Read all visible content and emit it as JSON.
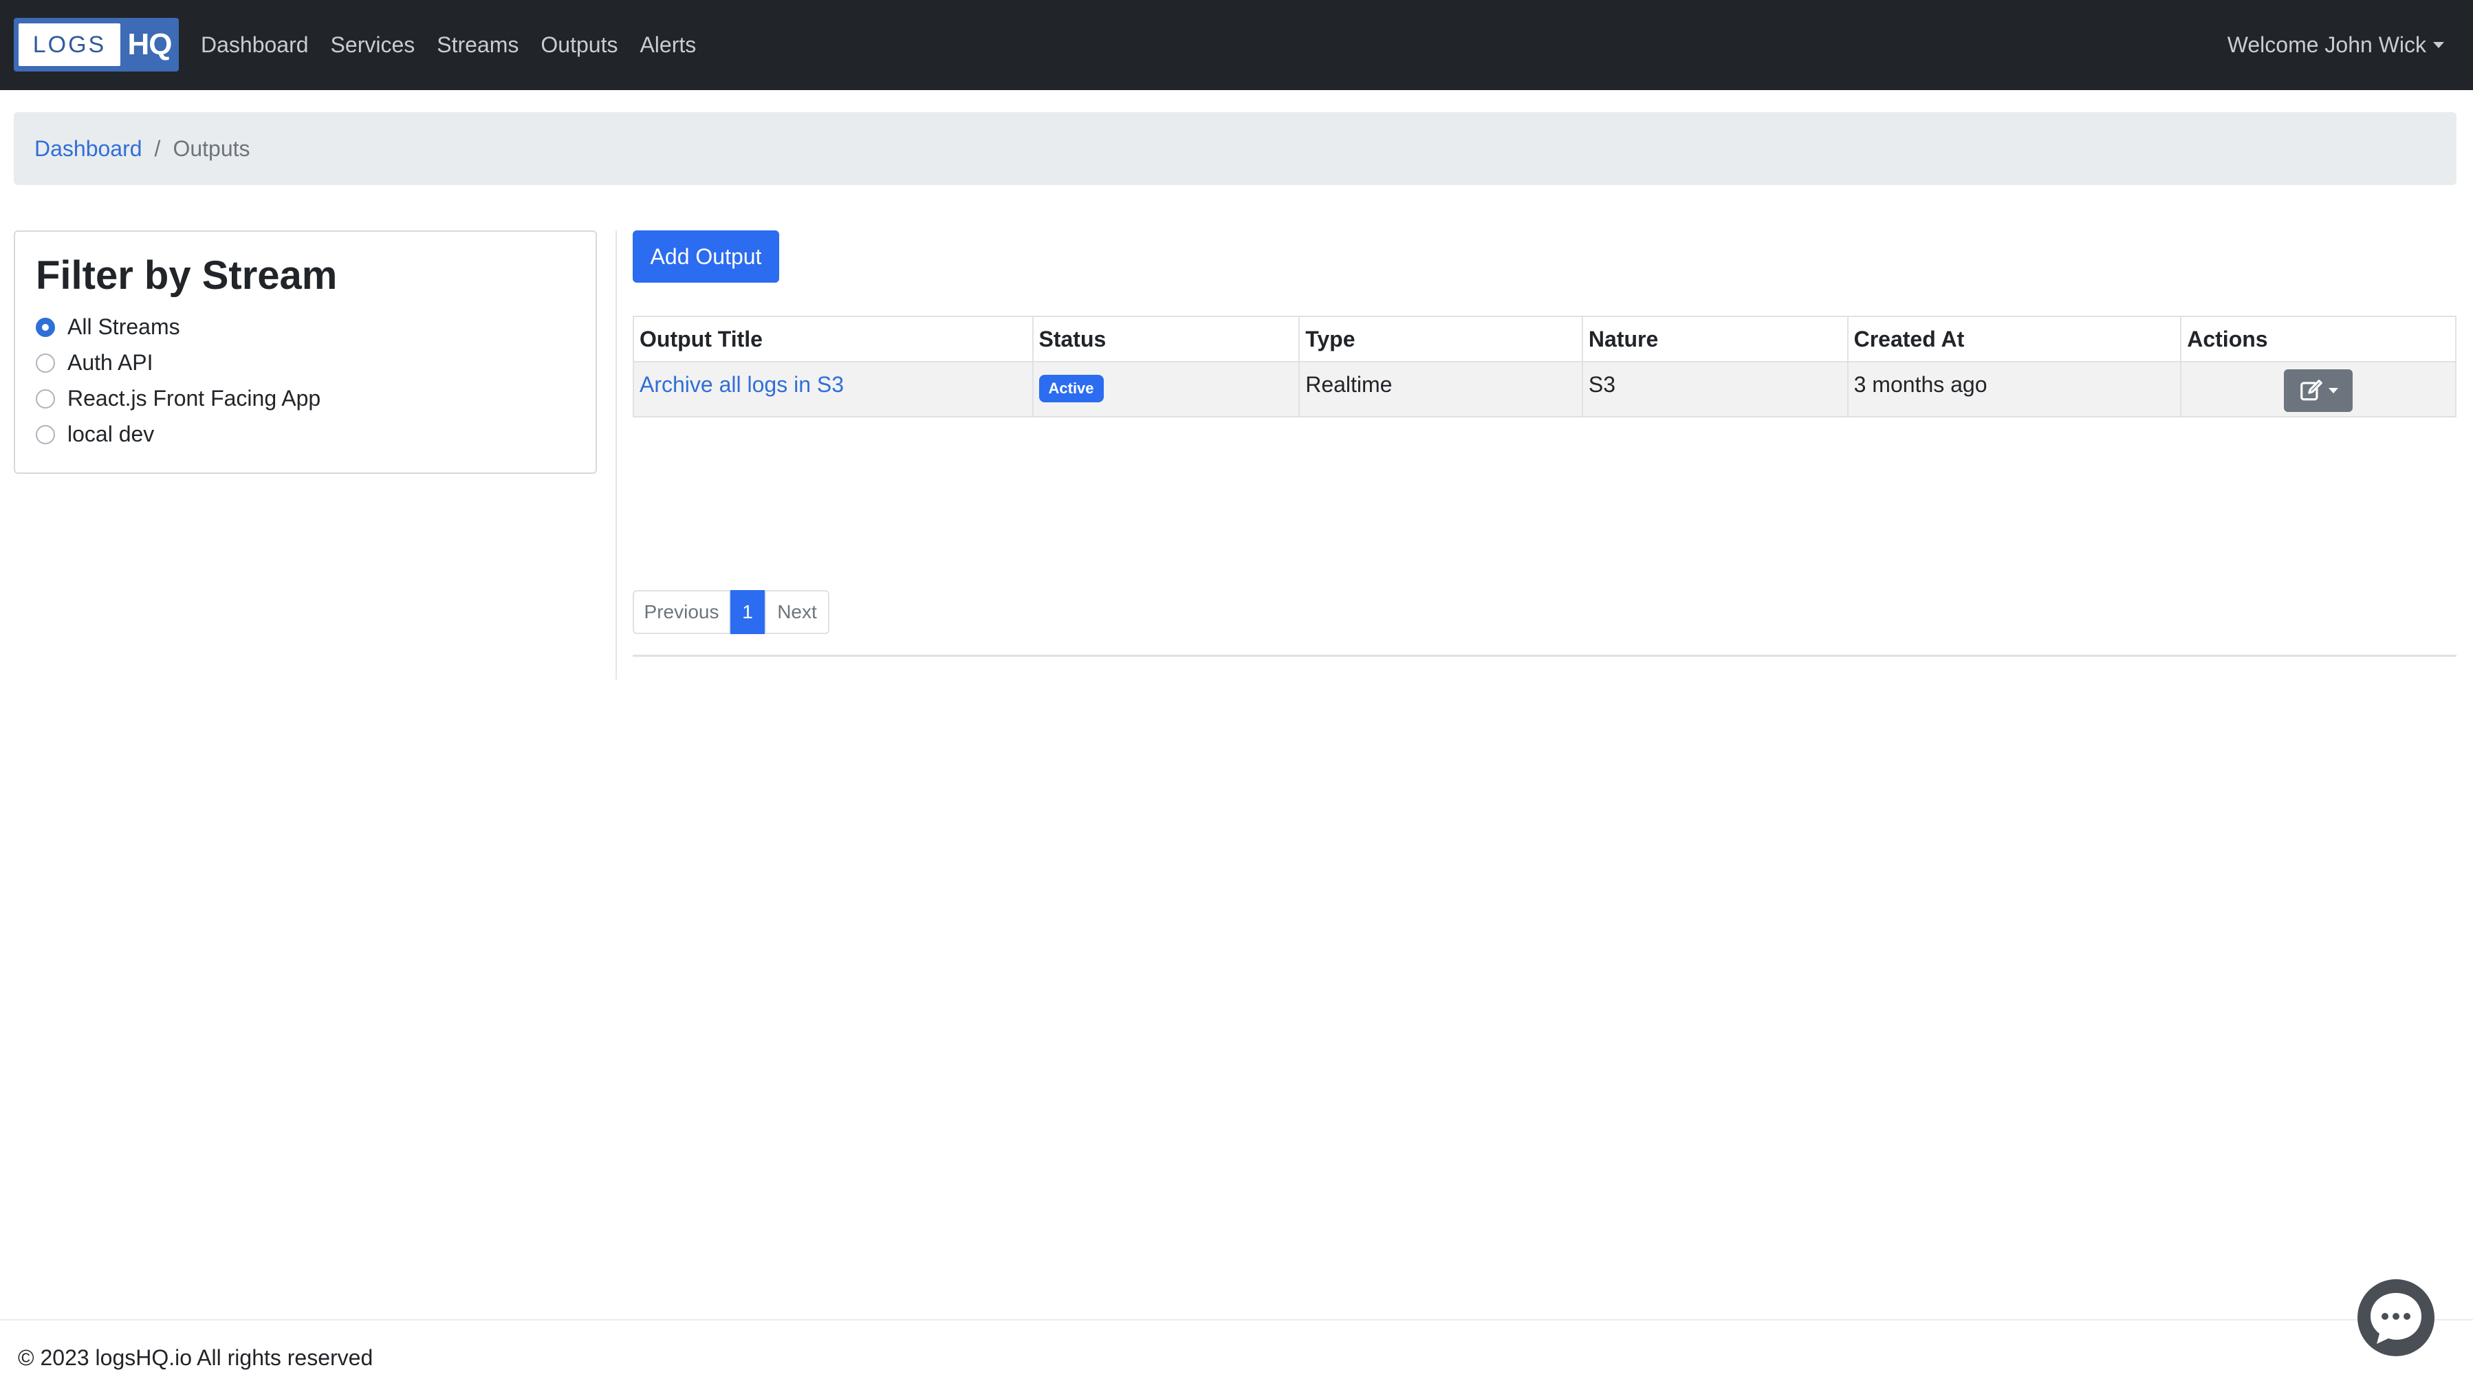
{
  "logo": {
    "left_text": "LOGS",
    "right_text": "HQ"
  },
  "nav": {
    "links": [
      "Dashboard",
      "Services",
      "Streams",
      "Outputs",
      "Alerts"
    ],
    "user_menu": "Welcome John Wick"
  },
  "breadcrumb": {
    "home": "Dashboard",
    "separator": "/",
    "current": "Outputs"
  },
  "filter": {
    "title": "Filter by Stream",
    "options": [
      {
        "label": "All Streams",
        "checked": true
      },
      {
        "label": "Auth API",
        "checked": false
      },
      {
        "label": "React.js Front Facing App",
        "checked": false
      },
      {
        "label": "local dev",
        "checked": false
      }
    ]
  },
  "add_output_label": "Add Output",
  "table": {
    "headers": [
      "Output Title",
      "Status",
      "Type",
      "Nature",
      "Created At",
      "Actions"
    ],
    "rows": [
      {
        "title": "Archive all logs in S3",
        "status": "Active",
        "type": "Realtime",
        "nature": "S3",
        "created_at": "3 months ago",
        "action_icon": "edit-icon"
      }
    ]
  },
  "pagination": {
    "previous": "Previous",
    "current_page": "1",
    "next": "Next"
  },
  "footer": {
    "text": "© 2023 logsHQ.io All rights reserved"
  },
  "icons": {
    "chat": "chat-bubble-icon",
    "edit": "edit-icon",
    "user_caret": "chevron-down-icon"
  },
  "colors": {
    "navbar": "#212529",
    "accent": "#2b6cf0",
    "link": "#2f6fd8",
    "breadcrumb_bg": "#e9ecef"
  }
}
